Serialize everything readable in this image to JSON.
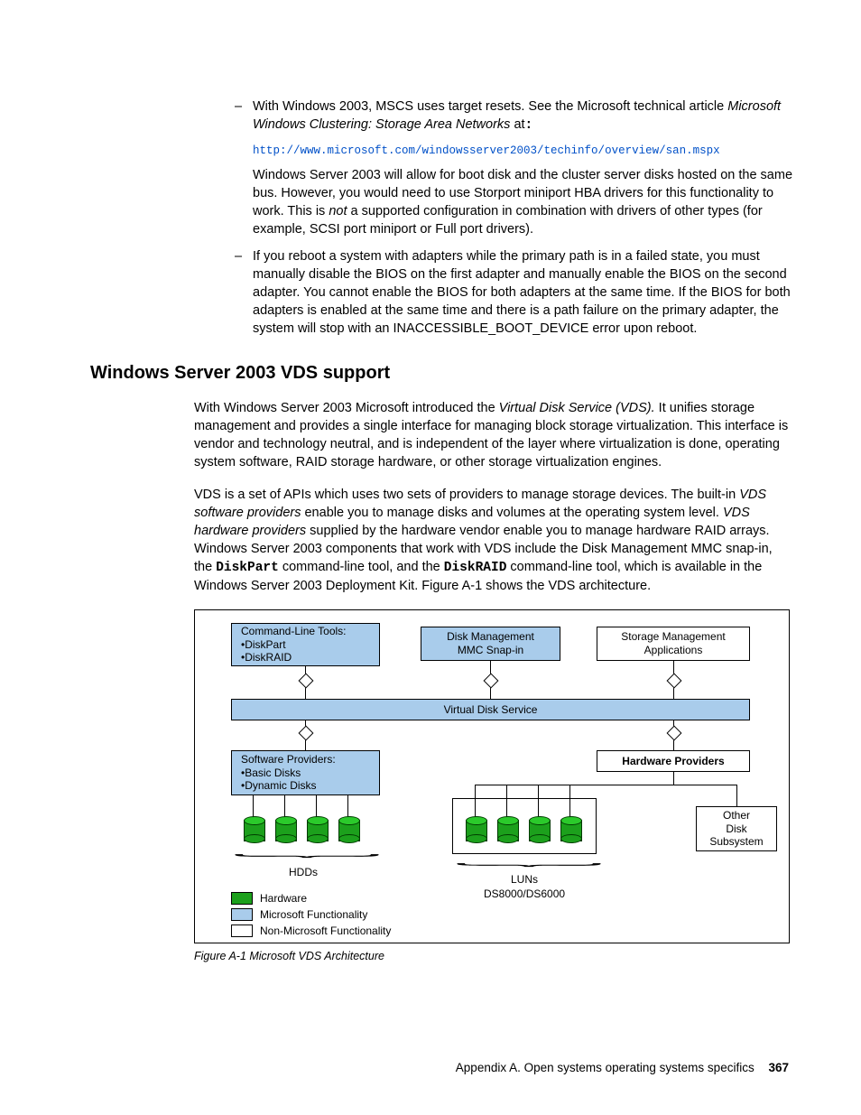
{
  "bullet1": {
    "text_a": "With Windows 2003, MSCS uses target resets. See the Microsoft technical article ",
    "italic": "Microsoft Windows Clustering: Storage Area Networks",
    "text_b": " at",
    "url": "http://www.microsoft.com/windowsserver2003/techinfo/overview/san.mspx",
    "para2_a": "Windows Server 2003 will allow for boot disk and the cluster server disks hosted on the same bus. However, you would need to use Storport miniport HBA drivers for this functionality to work. This is ",
    "para2_not": "not",
    "para2_b": " a supported configuration in combination with drivers of other types (for example, SCSI port miniport or Full port drivers)."
  },
  "bullet2": "If you reboot a system with adapters while the primary path is in a failed state, you must manually disable the BIOS on the first adapter and manually enable the BIOS on the second adapter. You cannot enable the BIOS for both adapters at the same time. If the BIOS for both adapters is enabled at the same time and there is a path failure on the primary adapter, the system will stop with an INACCESSIBLE_BOOT_DEVICE error upon reboot.",
  "heading": "Windows Server 2003 VDS support",
  "para1": {
    "a": "With Windows Server 2003 Microsoft introduced the ",
    "i1": "Virtual Disk Service (VDS).",
    "b": " It unifies storage management and provides a single interface for managing block storage virtualization. This interface is vendor and technology neutral, and is independent of the layer where virtualization is done, operating system software, RAID storage hardware, or other storage virtualization engines."
  },
  "para2": {
    "a": "VDS is a set of APIs which uses two sets of providers to manage storage devices. The built-in ",
    "i1": "VDS software providers",
    "b": " enable you to manage disks and volumes at the operating system level. ",
    "i2": "VDS hardware providers",
    "c": " supplied by the hardware vendor enable you to manage hardware RAID arrays. Windows Server 2003 components that work with VDS include the Disk Management MMC snap-in, the ",
    "m1": "DiskPart",
    "d": " command-line tool, and the ",
    "m2": "DiskRAID",
    "e": " command-line tool, which is available in the Windows Server 2003 Deployment Kit. Figure A-1 shows the VDS architecture."
  },
  "diagram": {
    "cmdline": "Command-Line Tools:\n•DiskPart\n•DiskRAID",
    "diskmgmt": "Disk Management\nMMC Snap-in",
    "storagemgmt": "Storage Management\nApplications",
    "vds": "Virtual Disk Service",
    "swprov": "Software Providers:\n•Basic Disks\n•Dynamic Disks",
    "hwprov": "Hardware Providers",
    "other": "Other\nDisk\nSubsystem",
    "hdds": "HDDs",
    "luns": "LUNs",
    "ds": "DS8000/DS6000",
    "leg_hw": "Hardware",
    "leg_ms": "Microsoft Functionality",
    "leg_nonms": "Non-Microsoft Functionality"
  },
  "caption": "Figure A-1   Microsoft VDS Architecture",
  "footer": {
    "text": "Appendix A. Open systems operating systems specifics",
    "page": "367"
  }
}
